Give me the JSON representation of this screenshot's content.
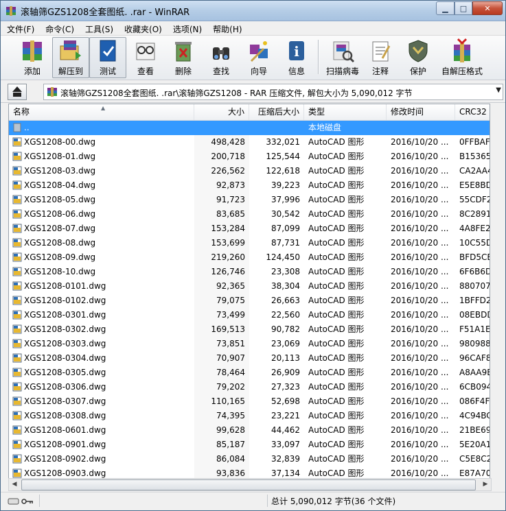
{
  "window": {
    "title": "滚轴筛GZS1208全套图纸. .rar - WinRAR",
    "min": "▁",
    "max": "□",
    "close": "✕"
  },
  "menu": [
    "文件(F)",
    "命令(C)",
    "工具(S)",
    "收藏夹(O)",
    "选项(N)",
    "帮助(H)"
  ],
  "toolbar": [
    {
      "label": "添加",
      "icon": "add-archive-icon"
    },
    {
      "label": "解压到",
      "icon": "extract-to-icon"
    },
    {
      "label": "测试",
      "icon": "test-icon"
    },
    {
      "label": "查看",
      "icon": "view-icon"
    },
    {
      "label": "删除",
      "icon": "delete-icon"
    },
    {
      "label": "查找",
      "icon": "find-icon"
    },
    {
      "label": "向导",
      "icon": "wizard-icon"
    },
    {
      "label": "信息",
      "icon": "info-icon"
    },
    {
      "label": "扫描病毒",
      "icon": "virus-scan-icon"
    },
    {
      "label": "注释",
      "icon": "comment-icon"
    },
    {
      "label": "保护",
      "icon": "protect-icon"
    },
    {
      "label": "自解压格式",
      "icon": "sfx-icon"
    }
  ],
  "address": {
    "text": "滚轴筛GZS1208全套图纸. .rar\\滚轴筛GZS1208 - RAR 压缩文件, 解包大小为 5,090,012 字节",
    "dropdown": "▼"
  },
  "columns": [
    "名称",
    "大小",
    "压缩后大小",
    "类型",
    "修改时间",
    "CRC32"
  ],
  "sort_arrow": "▲",
  "parent_row": {
    "name": "..",
    "type": "本地磁盘"
  },
  "files": [
    {
      "name": "XGS1208-00.dwg",
      "size": "498,428",
      "packed": "332,021",
      "type": "AutoCAD 图形",
      "modified": "2016/10/20 ...",
      "crc": "0FFBAF"
    },
    {
      "name": "XGS1208-01.dwg",
      "size": "200,718",
      "packed": "125,544",
      "type": "AutoCAD 图形",
      "modified": "2016/10/20 ...",
      "crc": "B15365"
    },
    {
      "name": "XGS1208-03.dwg",
      "size": "226,562",
      "packed": "122,618",
      "type": "AutoCAD 图形",
      "modified": "2016/10/20 ...",
      "crc": "CA2AA4"
    },
    {
      "name": "XGS1208-04.dwg",
      "size": "92,873",
      "packed": "39,223",
      "type": "AutoCAD 图形",
      "modified": "2016/10/20 ...",
      "crc": "E5E8BD"
    },
    {
      "name": "XGS1208-05.dwg",
      "size": "91,723",
      "packed": "37,996",
      "type": "AutoCAD 图形",
      "modified": "2016/10/20 ...",
      "crc": "55CDF2"
    },
    {
      "name": "XGS1208-06.dwg",
      "size": "83,685",
      "packed": "30,542",
      "type": "AutoCAD 图形",
      "modified": "2016/10/20 ...",
      "crc": "8C2891"
    },
    {
      "name": "XGS1208-07.dwg",
      "size": "153,284",
      "packed": "87,099",
      "type": "AutoCAD 图形",
      "modified": "2016/10/20 ...",
      "crc": "4A8FE2"
    },
    {
      "name": "XGS1208-08.dwg",
      "size": "153,699",
      "packed": "87,731",
      "type": "AutoCAD 图形",
      "modified": "2016/10/20 ...",
      "crc": "10C55D"
    },
    {
      "name": "XGS1208-09.dwg",
      "size": "219,260",
      "packed": "124,450",
      "type": "AutoCAD 图形",
      "modified": "2016/10/20 ...",
      "crc": "BFD5CE"
    },
    {
      "name": "XGS1208-10.dwg",
      "size": "126,746",
      "packed": "23,308",
      "type": "AutoCAD 图形",
      "modified": "2016/10/20 ...",
      "crc": "6F6B6D"
    },
    {
      "name": "XGS1208-0101.dwg",
      "size": "92,365",
      "packed": "38,304",
      "type": "AutoCAD 图形",
      "modified": "2016/10/20 ...",
      "crc": "880707"
    },
    {
      "name": "XGS1208-0102.dwg",
      "size": "79,075",
      "packed": "26,663",
      "type": "AutoCAD 图形",
      "modified": "2016/10/20 ...",
      "crc": "1BFFD2"
    },
    {
      "name": "XGS1208-0301.dwg",
      "size": "73,499",
      "packed": "22,560",
      "type": "AutoCAD 图形",
      "modified": "2016/10/20 ...",
      "crc": "08EBDD"
    },
    {
      "name": "XGS1208-0302.dwg",
      "size": "169,513",
      "packed": "90,782",
      "type": "AutoCAD 图形",
      "modified": "2016/10/20 ...",
      "crc": "F51A1E"
    },
    {
      "name": "XGS1208-0303.dwg",
      "size": "73,851",
      "packed": "23,069",
      "type": "AutoCAD 图形",
      "modified": "2016/10/20 ...",
      "crc": "980988"
    },
    {
      "name": "XGS1208-0304.dwg",
      "size": "70,907",
      "packed": "20,113",
      "type": "AutoCAD 图形",
      "modified": "2016/10/20 ...",
      "crc": "96CAF8"
    },
    {
      "name": "XGS1208-0305.dwg",
      "size": "78,464",
      "packed": "26,909",
      "type": "AutoCAD 图形",
      "modified": "2016/10/20 ...",
      "crc": "A8AA9E"
    },
    {
      "name": "XGS1208-0306.dwg",
      "size": "79,202",
      "packed": "27,323",
      "type": "AutoCAD 图形",
      "modified": "2016/10/20 ...",
      "crc": "6CB094"
    },
    {
      "name": "XGS1208-0307.dwg",
      "size": "110,165",
      "packed": "52,698",
      "type": "AutoCAD 图形",
      "modified": "2016/10/20 ...",
      "crc": "086F4F"
    },
    {
      "name": "XGS1208-0308.dwg",
      "size": "74,395",
      "packed": "23,221",
      "type": "AutoCAD 图形",
      "modified": "2016/10/20 ...",
      "crc": "4C94BC"
    },
    {
      "name": "XGS1208-0601.dwg",
      "size": "99,628",
      "packed": "44,462",
      "type": "AutoCAD 图形",
      "modified": "2016/10/20 ...",
      "crc": "21BE69"
    },
    {
      "name": "XGS1208-0901.dwg",
      "size": "85,187",
      "packed": "33,097",
      "type": "AutoCAD 图形",
      "modified": "2016/10/20 ...",
      "crc": "5E20A1"
    },
    {
      "name": "XGS1208-0902.dwg",
      "size": "86,084",
      "packed": "32,839",
      "type": "AutoCAD 图形",
      "modified": "2016/10/20 ...",
      "crc": "C5E8C2"
    },
    {
      "name": "XGS1208-0903.dwg",
      "size": "93,836",
      "packed": "37,134",
      "type": "AutoCAD 图形",
      "modified": "2016/10/20 ...",
      "crc": "E87A70"
    }
  ],
  "status": {
    "summary": "总计 5,090,012 字节(36 个文件)"
  },
  "scroll": {
    "left": "◀",
    "right": "▶"
  }
}
